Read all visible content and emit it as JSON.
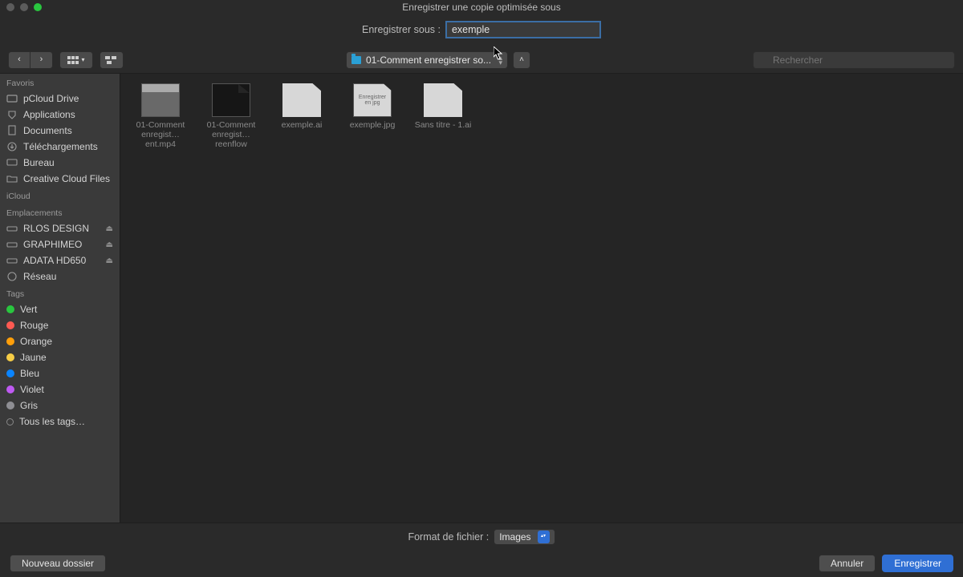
{
  "window": {
    "title": "Enregistrer une copie optimisée sous"
  },
  "filename": {
    "label": "Enregistrer sous :",
    "value": "exemple"
  },
  "location": {
    "folder_label": "01-Comment enregistrer so..."
  },
  "search": {
    "placeholder": "Rechercher"
  },
  "sidebar": {
    "favorites_label": "Favoris",
    "icloud_label": "iCloud",
    "locations_label": "Emplacements",
    "tags_label": "Tags",
    "favorites": [
      {
        "label": "pCloud Drive"
      },
      {
        "label": "Applications"
      },
      {
        "label": "Documents"
      },
      {
        "label": "Téléchargements"
      },
      {
        "label": "Bureau"
      },
      {
        "label": "Creative Cloud Files"
      }
    ],
    "locations": [
      {
        "label": "RLOS DESIGN"
      },
      {
        "label": "GRAPHIMEO"
      },
      {
        "label": "ADATA HD650"
      },
      {
        "label": "Réseau"
      }
    ],
    "tags": [
      {
        "label": "Vert",
        "color": "#29c63f"
      },
      {
        "label": "Rouge",
        "color": "#ff5a52"
      },
      {
        "label": "Orange",
        "color": "#ff9f0a"
      },
      {
        "label": "Jaune",
        "color": "#f7cd46"
      },
      {
        "label": "Bleu",
        "color": "#0a84ff"
      },
      {
        "label": "Violet",
        "color": "#bf5af2"
      },
      {
        "label": "Gris",
        "color": "#8e8e93"
      },
      {
        "label": "Tous les tags…"
      }
    ]
  },
  "files": [
    {
      "name": "01-Comment enregist…ent.mp4"
    },
    {
      "name": "01-Comment enregist…reenflow"
    },
    {
      "name": "exemple.ai"
    },
    {
      "name": "exemple.jpg",
      "thumb_text": "Enregistrer en jpg"
    },
    {
      "name": "Sans titre - 1.ai"
    }
  ],
  "format": {
    "label": "Format de fichier :",
    "value": "Images"
  },
  "buttons": {
    "new_folder": "Nouveau dossier",
    "cancel": "Annuler",
    "save": "Enregistrer"
  }
}
